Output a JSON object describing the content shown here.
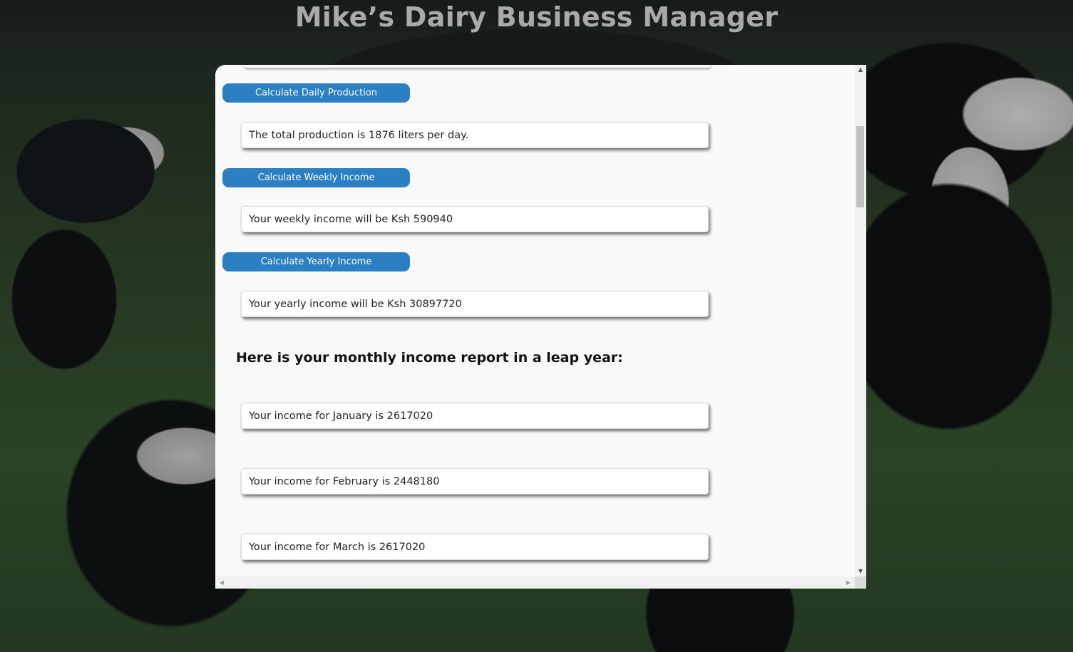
{
  "app": {
    "title": "Mike’s Dairy Business Manager"
  },
  "buttons": {
    "daily": "Calculate Daily Production",
    "weekly": "Calculate Weekly Income",
    "yearly": "Calculate Yearly Income"
  },
  "results": {
    "daily": "The total production is 1876 liters per day.",
    "weekly": "Your weekly income will be Ksh 590940",
    "yearly": "Your yearly income will be Ksh 30897720"
  },
  "report": {
    "heading": "Here is your monthly income report in a leap year:",
    "months": [
      "Your income for January is 2617020",
      "Your income for February is 2448180",
      "Your income for March is 2617020"
    ]
  },
  "scrollbar": {
    "up_icon": "triangle-up-icon",
    "down_icon": "triangle-down-icon",
    "left_icon": "triangle-left-icon",
    "right_icon": "triangle-right-icon"
  },
  "colors": {
    "button": "#2b7fc3",
    "panel": "#f9f9f9",
    "title": "#a9a9a9"
  }
}
